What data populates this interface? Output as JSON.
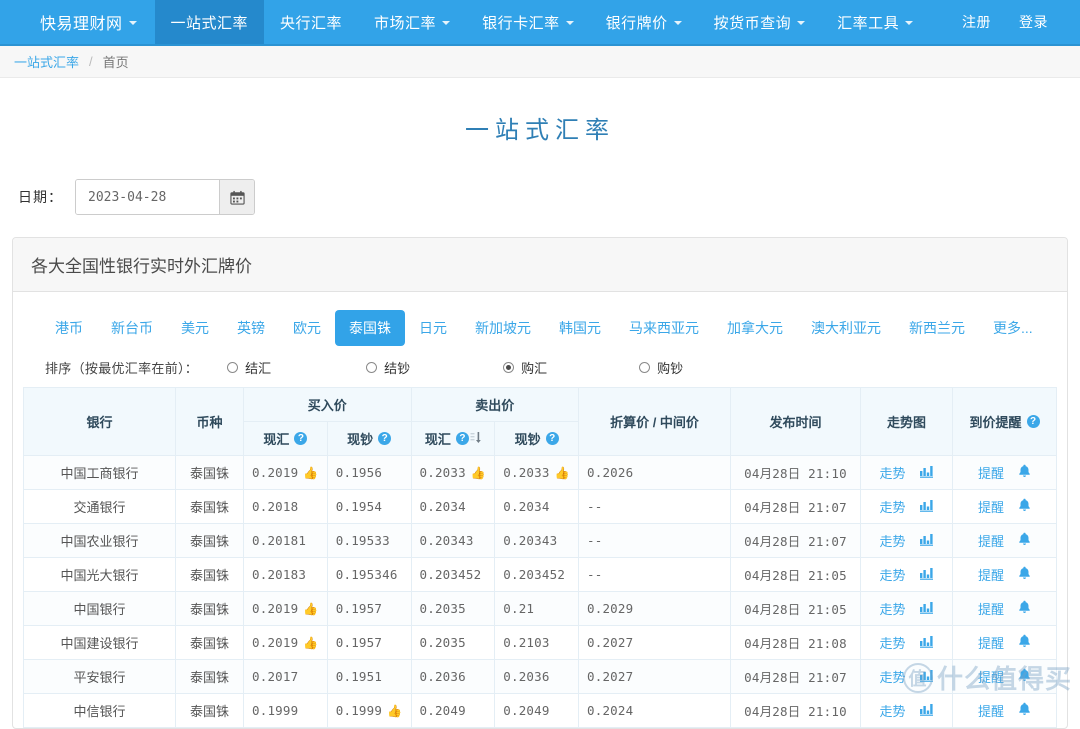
{
  "nav": {
    "brand": "快易理财网",
    "items": [
      {
        "label": "一站式汇率",
        "caret": false,
        "active": true
      },
      {
        "label": "央行汇率",
        "caret": false,
        "active": false
      },
      {
        "label": "市场汇率",
        "caret": true,
        "active": false
      },
      {
        "label": "银行卡汇率",
        "caret": true,
        "active": false
      },
      {
        "label": "银行牌价",
        "caret": true,
        "active": false
      },
      {
        "label": "按货币查询",
        "caret": true,
        "active": false
      },
      {
        "label": "汇率工具",
        "caret": true,
        "active": false
      }
    ],
    "register": "注册",
    "login": "登录"
  },
  "breadcrumb": {
    "link": "一站式汇率",
    "sep": "/",
    "current": "首页"
  },
  "page_title": "一站式汇率",
  "date_filter": {
    "label": "日期：",
    "value": "2023-04-28",
    "placeholder": "2023-04-28",
    "icon": "calendar-icon"
  },
  "panel": {
    "title": "各大全国性银行实时外汇牌价",
    "currency_tabs": [
      {
        "label": "港币",
        "active": false
      },
      {
        "label": "新台币",
        "active": false
      },
      {
        "label": "美元",
        "active": false
      },
      {
        "label": "英镑",
        "active": false
      },
      {
        "label": "欧元",
        "active": false
      },
      {
        "label": "泰国铢",
        "active": true
      },
      {
        "label": "日元",
        "active": false
      },
      {
        "label": "新加坡元",
        "active": false
      },
      {
        "label": "韩国元",
        "active": false
      },
      {
        "label": "马来西亚元",
        "active": false
      },
      {
        "label": "加拿大元",
        "active": false
      },
      {
        "label": "澳大利亚元",
        "active": false
      },
      {
        "label": "新西兰元",
        "active": false
      },
      {
        "label": "更多...",
        "active": false
      }
    ],
    "sort": {
      "label": "排序（按最优汇率在前）：",
      "options": [
        {
          "label": "结汇",
          "selected": false
        },
        {
          "label": "结钞",
          "selected": false
        },
        {
          "label": "购汇",
          "selected": true
        },
        {
          "label": "购钞",
          "selected": false
        }
      ]
    }
  },
  "table": {
    "headers": {
      "bank": "银行",
      "currency": "币种",
      "buy_group": "买入价",
      "sell_group": "卖出价",
      "spot": "现汇",
      "cash": "现钞",
      "conversion": "折算价 / 中间价",
      "publish_time": "发布时间",
      "trend": "走势图",
      "alert": "到价提醒"
    },
    "row_actions": {
      "trend": "走势",
      "alert": "提醒"
    },
    "rows": [
      {
        "bank": "中国工商银行",
        "currency": "泰国铢",
        "buy_spot": "0.2019",
        "buy_spot_best": true,
        "buy_cash": "0.1956",
        "buy_cash_best": false,
        "sell_spot": "0.2033",
        "sell_spot_best": true,
        "sell_cash": "0.2033",
        "sell_cash_best": true,
        "conversion": "0.2026",
        "time": "04月28日 21:10"
      },
      {
        "bank": "交通银行",
        "currency": "泰国铢",
        "buy_spot": "0.2018",
        "buy_spot_best": false,
        "buy_cash": "0.1954",
        "buy_cash_best": false,
        "sell_spot": "0.2034",
        "sell_spot_best": false,
        "sell_cash": "0.2034",
        "sell_cash_best": false,
        "conversion": "--",
        "time": "04月28日 21:07"
      },
      {
        "bank": "中国农业银行",
        "currency": "泰国铢",
        "buy_spot": "0.20181",
        "buy_spot_best": false,
        "buy_cash": "0.19533",
        "buy_cash_best": false,
        "sell_spot": "0.20343",
        "sell_spot_best": false,
        "sell_cash": "0.20343",
        "sell_cash_best": false,
        "conversion": "--",
        "time": "04月28日 21:07"
      },
      {
        "bank": "中国光大银行",
        "currency": "泰国铢",
        "buy_spot": "0.20183",
        "buy_spot_best": false,
        "buy_cash": "0.195346",
        "buy_cash_best": false,
        "sell_spot": "0.203452",
        "sell_spot_best": false,
        "sell_cash": "0.203452",
        "sell_cash_best": false,
        "conversion": "--",
        "time": "04月28日 21:05"
      },
      {
        "bank": "中国银行",
        "currency": "泰国铢",
        "buy_spot": "0.2019",
        "buy_spot_best": true,
        "buy_cash": "0.1957",
        "buy_cash_best": false,
        "sell_spot": "0.2035",
        "sell_spot_best": false,
        "sell_cash": "0.21",
        "sell_cash_best": false,
        "conversion": "0.2029",
        "time": "04月28日 21:05"
      },
      {
        "bank": "中国建设银行",
        "currency": "泰国铢",
        "buy_spot": "0.2019",
        "buy_spot_best": true,
        "buy_cash": "0.1957",
        "buy_cash_best": false,
        "sell_spot": "0.2035",
        "sell_spot_best": false,
        "sell_cash": "0.2103",
        "sell_cash_best": false,
        "conversion": "0.2027",
        "time": "04月28日 21:08"
      },
      {
        "bank": "平安银行",
        "currency": "泰国铢",
        "buy_spot": "0.2017",
        "buy_spot_best": false,
        "buy_cash": "0.1951",
        "buy_cash_best": false,
        "sell_spot": "0.2036",
        "sell_spot_best": false,
        "sell_cash": "0.2036",
        "sell_cash_best": false,
        "conversion": "0.2027",
        "time": "04月28日 21:07"
      },
      {
        "bank": "中信银行",
        "currency": "泰国铢",
        "buy_spot": "0.1999",
        "buy_spot_best": false,
        "buy_cash": "0.1999",
        "buy_cash_best": true,
        "sell_spot": "0.2049",
        "sell_spot_best": false,
        "sell_cash": "0.2049",
        "sell_cash_best": false,
        "conversion": "0.2024",
        "time": "04月28日 21:10"
      }
    ]
  },
  "watermark": {
    "mark": "值",
    "text": "什么值得买"
  },
  "colors": {
    "brand_blue": "#32a3e8",
    "active_tab": "#2589cc",
    "link": "#3ba7e8",
    "best_rate": "#e8352b",
    "title": "#2f7fb5"
  }
}
